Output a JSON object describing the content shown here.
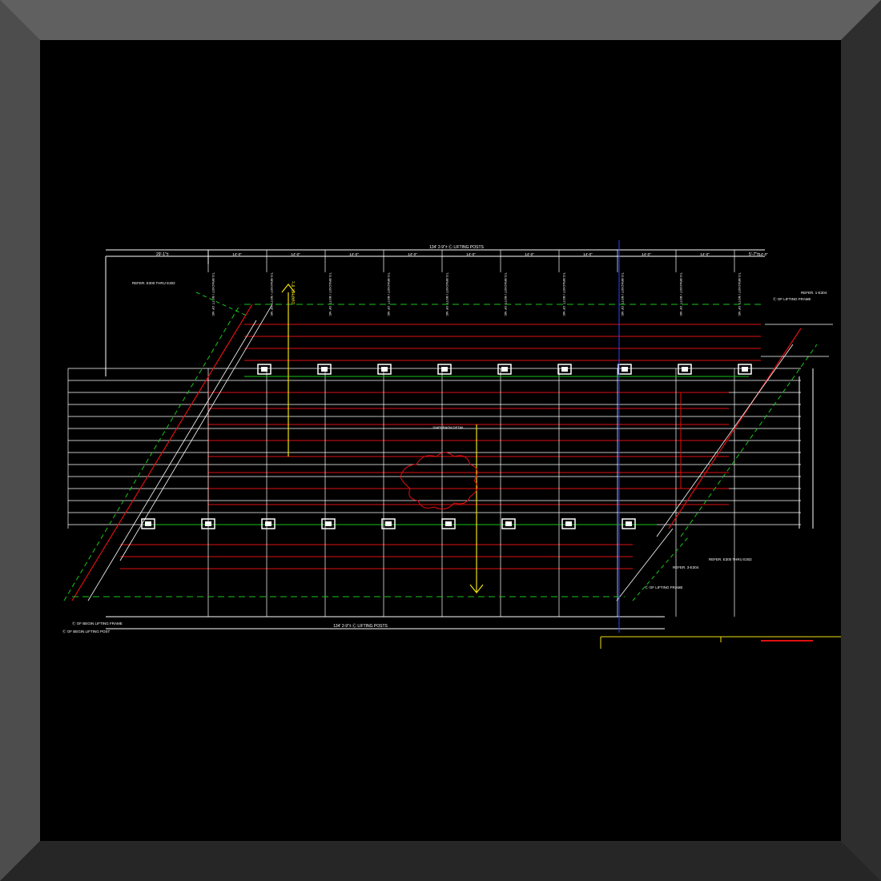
{
  "drawing": {
    "title_top": "134' 2-9\"± Ⓒ LIFTING POSTS",
    "title_bottom": "134' 2-9\"± Ⓒ LIFTING POSTS",
    "left_top_dim": "29'-1\"±",
    "right_top_dim": "5'-7\"±",
    "bay_dim": "14'-0\"",
    "refer_top_left": "REFER. E300 THRU E302",
    "refer_top_right": "REFER. 1-E304",
    "refer_bottom_right_1": "REFER. E300 THRU E302",
    "refer_bottom_right_2": "REFER. 3-E304",
    "lift_frame_left": "Ⓒ OF BEGIN LIFTING FRAME",
    "lift_post_left": "Ⓒ OF BEGIN LIFTING POST",
    "lift_frame_right": "Ⓒ OF LIFTING FRAME",
    "lift_frame_top_right": "Ⓒ OF LIFTING FRAME",
    "bracket_label": "T.O.BRACKET / BOTT. OF MC",
    "cl_label": "DIAPHR. 8\"±",
    "center_note": "DIAPHRAGM DETAIL"
  },
  "colors": {
    "background": "#000000",
    "frame": "#3a3a3a",
    "white": "#ffffff",
    "red": "#e01010",
    "green": "#19c519",
    "yellow": "#f0e010",
    "blue": "#3040ff"
  }
}
